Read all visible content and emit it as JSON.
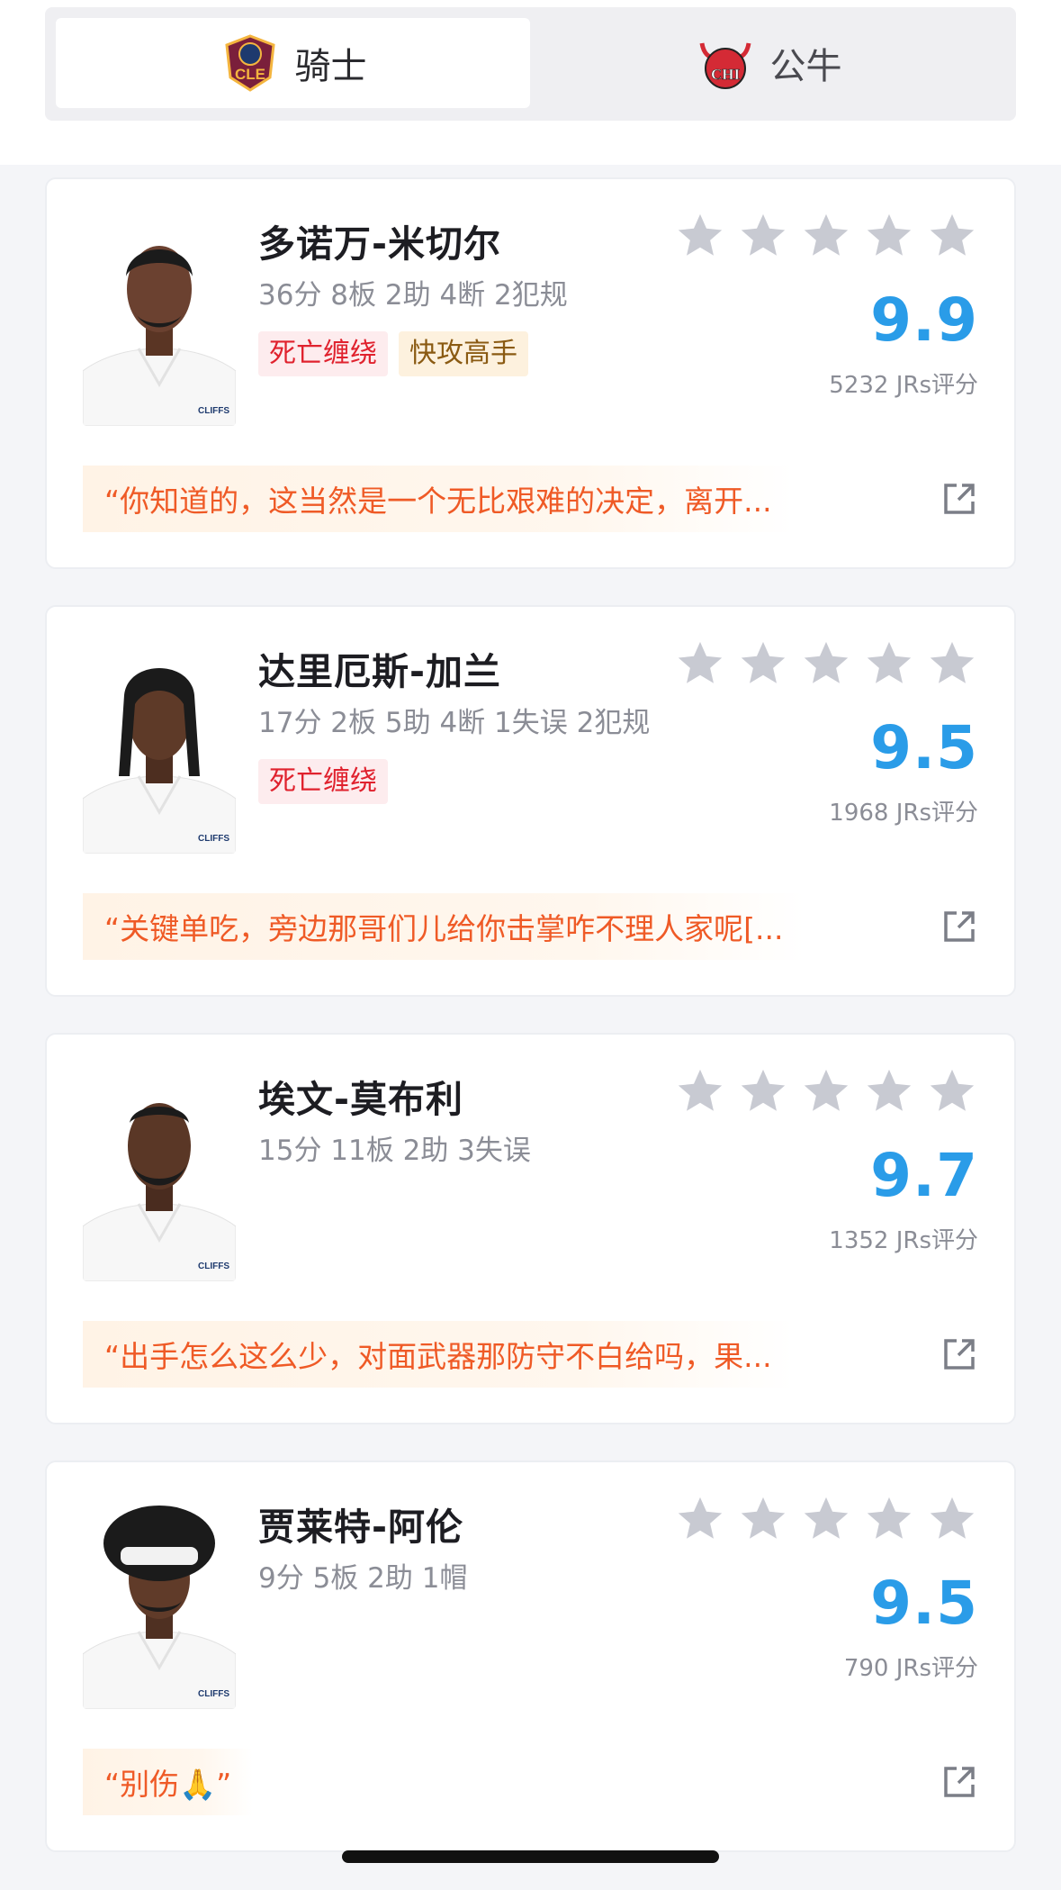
{
  "tabs": [
    {
      "label": "骑士",
      "logo_text": "CLE",
      "active": true
    },
    {
      "label": "公牛",
      "logo_text": "CHI",
      "active": false
    }
  ],
  "players": [
    {
      "name": "多诺万-米切尔",
      "stats": "36分 8板 2助 4断 2犯规",
      "tags": [
        {
          "text": "死亡缠绕",
          "style": "red"
        },
        {
          "text": "快攻高手",
          "style": "orange"
        }
      ],
      "score": "9.9",
      "rating_count": "5232 JRs评分",
      "comment": "“你知道的，这当然是一个无比艰难的决定，离开...",
      "jersey_text": "CLIFFS"
    },
    {
      "name": "达里厄斯-加兰",
      "stats": "17分 2板 5助 4断 1失误 2犯规",
      "tags": [
        {
          "text": "死亡缠绕",
          "style": "red"
        }
      ],
      "score": "9.5",
      "rating_count": "1968 JRs评分",
      "comment": "“关键单吃，旁边那哥们儿给你击掌咋不理人家呢[...",
      "jersey_text": "CLIFFS"
    },
    {
      "name": "埃文-莫布利",
      "stats": "15分 11板 2助 3失误",
      "tags": [],
      "score": "9.7",
      "rating_count": "1352 JRs评分",
      "comment": "“出手怎么这么少，对面武器那防守不白给吗，果...",
      "jersey_text": "CLIFFS"
    },
    {
      "name": "贾莱特-阿伦",
      "stats": "9分 5板 2助 1帽",
      "tags": [],
      "score": "9.5",
      "rating_count": "790 JRs评分",
      "comment": "“别伤🙏”",
      "jersey_text": "CLIFFS"
    }
  ],
  "icons": {
    "star": "star-icon",
    "share": "share-icon",
    "tab_logo_active": "cavaliers-logo-icon",
    "tab_logo_inactive": "bulls-logo-icon"
  },
  "colors": {
    "score": "#2a9ce8",
    "comment": "#ef5a26",
    "star": "#c8cad2",
    "tag_red": "#e0222e",
    "tag_orange": "#8a5a12",
    "bulls_red": "#d42a35",
    "cavs_wine": "#7a1f3b"
  }
}
